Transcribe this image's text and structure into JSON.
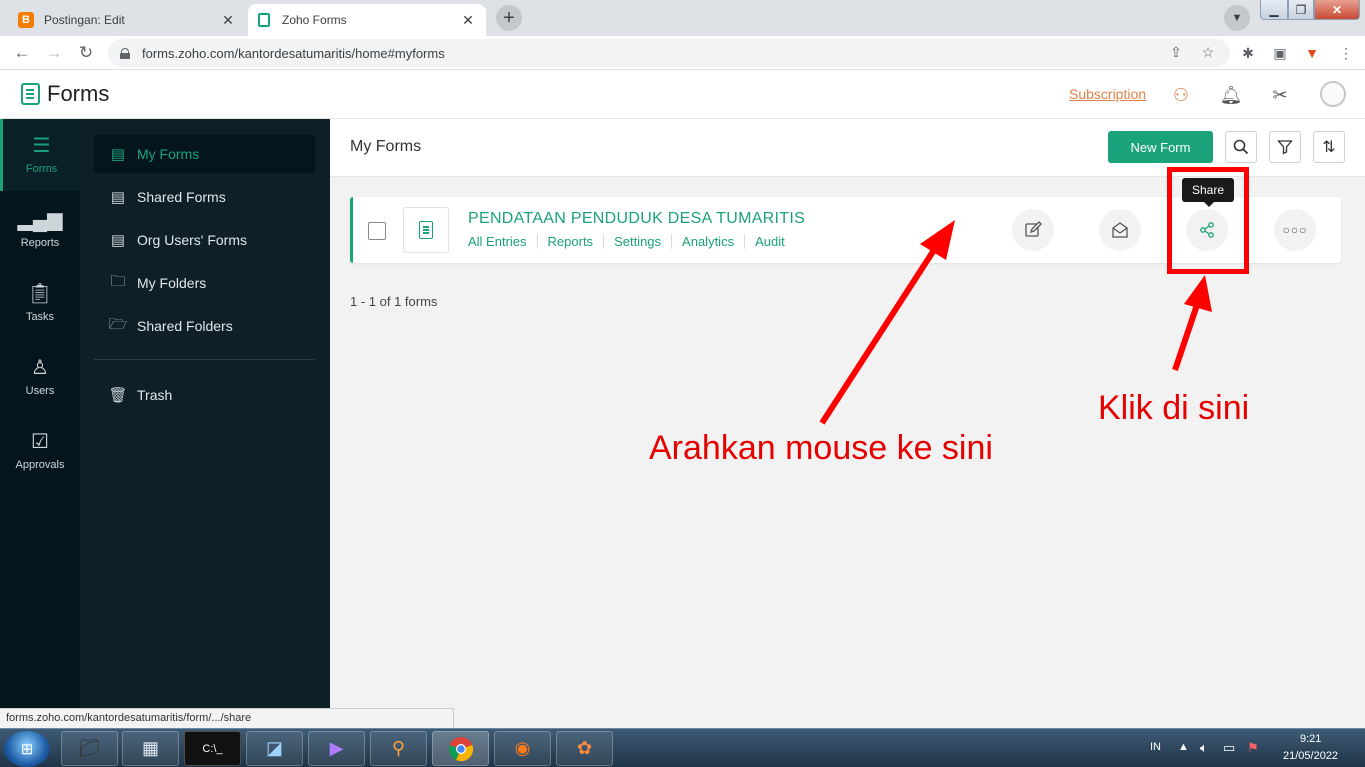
{
  "browser": {
    "tabs": [
      {
        "title": "Postingan: Edit",
        "icon": "blogger-icon"
      },
      {
        "title": "Zoho Forms",
        "icon": "zoho-forms-icon"
      }
    ],
    "url": "forms.zoho.com/kantordesatumaritis/home#myforms",
    "status_url": "forms.zoho.com/kantordesatumaritis/form/.../share"
  },
  "app": {
    "title": "Forms",
    "subscription": "Subscription"
  },
  "rail": [
    {
      "label": "Forms",
      "icon": "forms-icon"
    },
    {
      "label": "Reports",
      "icon": "reports-icon"
    },
    {
      "label": "Tasks",
      "icon": "tasks-icon"
    },
    {
      "label": "Users",
      "icon": "users-icon"
    },
    {
      "label": "Approvals",
      "icon": "approvals-icon"
    }
  ],
  "sidebar": [
    {
      "label": "My Forms",
      "icon": "form-doc-icon"
    },
    {
      "label": "Shared Forms",
      "icon": "shared-forms-icon"
    },
    {
      "label": "Org Users' Forms",
      "icon": "org-forms-icon"
    },
    {
      "label": "My Folders",
      "icon": "folder-icon"
    },
    {
      "label": "Shared Folders",
      "icon": "shared-folder-icon"
    },
    {
      "label": "Trash",
      "icon": "trash-icon"
    }
  ],
  "main": {
    "title": "My Forms",
    "new_form": "New Form",
    "form": {
      "name": "PENDATAAN PENDUDUK DESA TUMARITIS",
      "links": [
        "All Entries",
        "Reports",
        "Settings",
        "Analytics",
        "Audit"
      ]
    },
    "tooltip": "Share",
    "count": "1 - 1 of 1 forms"
  },
  "annotations": {
    "hover": "Arahkan mouse ke sini",
    "click": "Klik di sini",
    "color": "#e60000"
  },
  "taskbar": {
    "lang": "IN",
    "time": "9:21",
    "date": "21/05/2022"
  }
}
